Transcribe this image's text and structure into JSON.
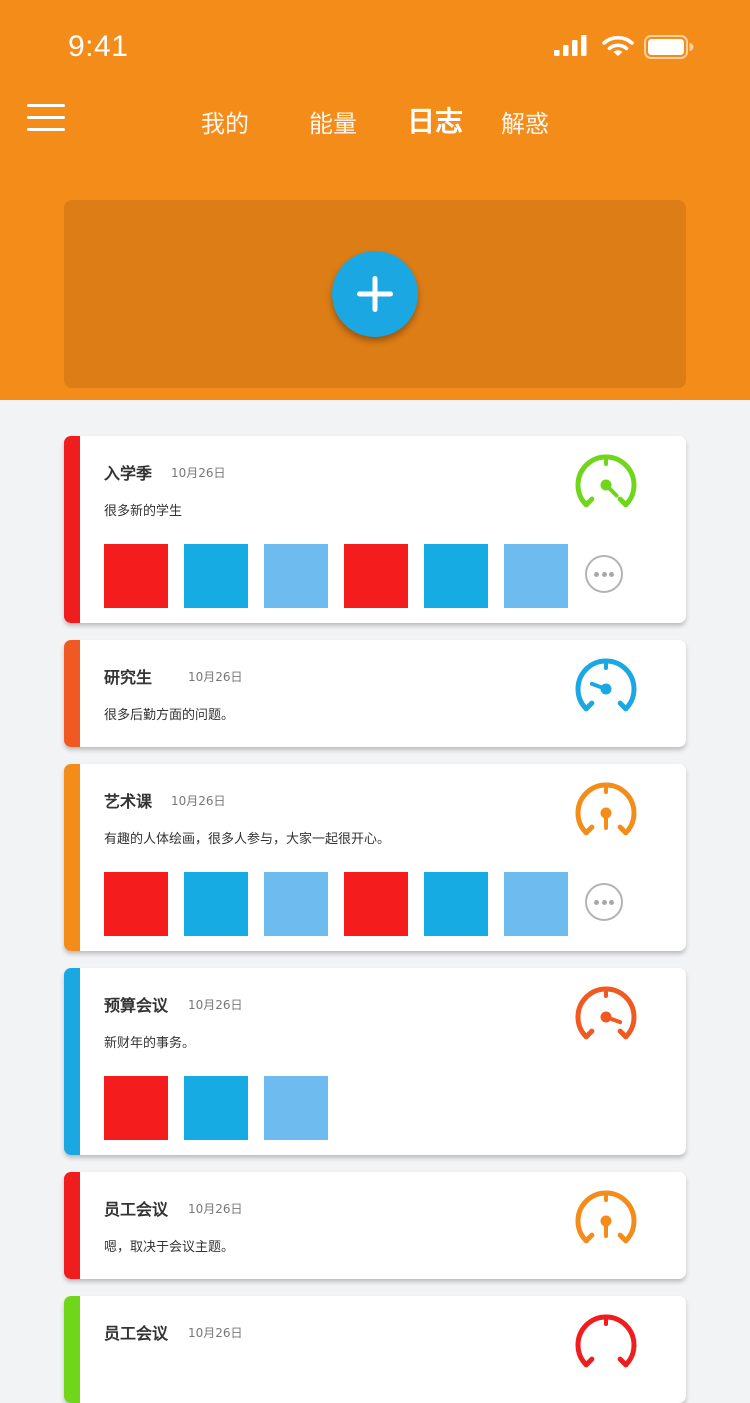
{
  "status_bar": {
    "time": "9:41",
    "icons": [
      "signal-icon",
      "wifi-icon",
      "battery-icon"
    ]
  },
  "nav": {
    "menu_icon": "menu-icon",
    "tabs": [
      {
        "label": "我的",
        "active": false
      },
      {
        "label": "能量",
        "active": false
      },
      {
        "label": "日志",
        "active": true
      },
      {
        "label": "解惑",
        "active": false
      }
    ]
  },
  "add_button": {
    "icon": "plus-icon"
  },
  "colors": {
    "header_bg": "#f48c1a",
    "panel_bg": "#dd7d16",
    "add_button": "#1ba8e2",
    "thumb_red": "#f41c1c",
    "thumb_blue": "#17abe4",
    "thumb_light_blue": "#6ebbef"
  },
  "logs": [
    {
      "title": "入学季",
      "date": "10月26日",
      "description": "很多新的学生",
      "accent": "#ef1d1d",
      "gauge_color": "#6fd619",
      "gauge_level": "low",
      "thumbnails": 6,
      "more": true
    },
    {
      "title": "研究生",
      "date": "10月26日",
      "description": "很多后勤方面的问题。",
      "accent": "#f05a22",
      "gauge_color": "#1ba8e2",
      "gauge_level": "high",
      "thumbnails": 0,
      "more": false
    },
    {
      "title": "艺术课",
      "date": "10月26日",
      "description": "有趣的人体绘画，很多人参与，大家一起很开心。",
      "accent": "#f48c1a",
      "gauge_color": "#f48c1a",
      "gauge_level": "medium",
      "thumbnails": 6,
      "more": true
    },
    {
      "title": "预算会议",
      "date": "10月26日",
      "description": "新财年的事务。",
      "accent": "#1ba8e2",
      "gauge_color": "#f05a22",
      "gauge_level": "medium-low",
      "thumbnails": 3,
      "more": false
    },
    {
      "title": "员工会议",
      "date": "10月26日",
      "description": "嗯，取决于会议主题。",
      "accent": "#ef1d1d",
      "gauge_color": "#f48c1a",
      "gauge_level": "medium",
      "thumbnails": 0,
      "more": false
    },
    {
      "title": "员工会议",
      "date": "10月26日",
      "description": "",
      "accent": "#6fd619",
      "gauge_color": "#ef1d1d",
      "gauge_level": "",
      "thumbnails": 0,
      "more": false
    }
  ]
}
